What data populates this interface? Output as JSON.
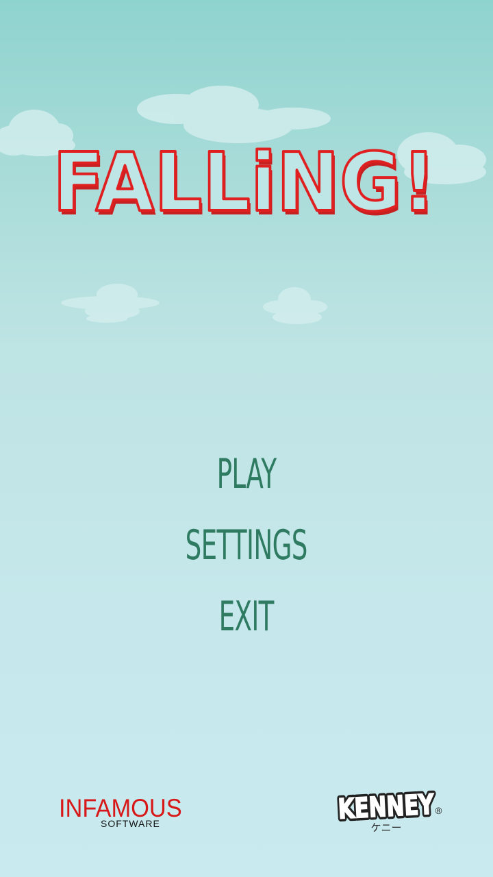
{
  "game": {
    "title": "FALLiNG!"
  },
  "menu": {
    "items": [
      {
        "label": "PLAY"
      },
      {
        "label": "SETTINGS"
      },
      {
        "label": "EXIT"
      }
    ]
  },
  "credits": {
    "infamous_main": "INFAMOUS",
    "infamous_sub": "SOFTWARE",
    "kenney_main": "KENNEY",
    "kenney_sub": "ケニー",
    "kenney_mark": "®"
  },
  "colors": {
    "title_fill": "#bfe6e6",
    "title_outline": "#e02020",
    "menu_text": "#2e7b62",
    "infamous_red": "#d81818"
  }
}
